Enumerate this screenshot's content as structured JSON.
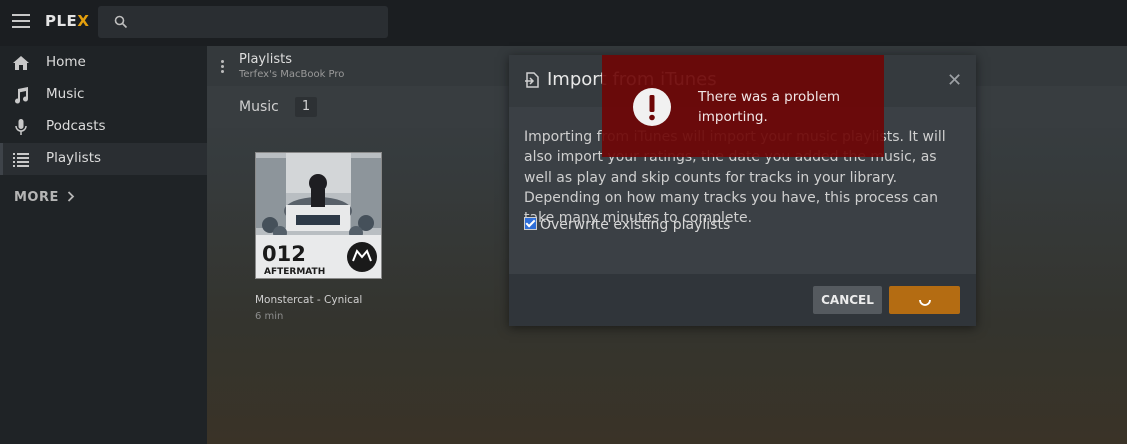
{
  "app": {
    "logo_main": "PLE",
    "logo_x": "X"
  },
  "search": {
    "placeholder": ""
  },
  "sidebar": {
    "items": [
      {
        "label": "Home",
        "icon": "home-icon"
      },
      {
        "label": "Music",
        "icon": "music-note-icon"
      },
      {
        "label": "Podcasts",
        "icon": "microphone-icon"
      },
      {
        "label": "Playlists",
        "icon": "list-icon",
        "active": true
      }
    ],
    "more": "MORE"
  },
  "header": {
    "title": "Playlists",
    "subtitle": "Terfex's MacBook Pro"
  },
  "filter": {
    "label": "Music",
    "count": "1"
  },
  "card": {
    "title": "Monstercat - Cynical",
    "meta": "6 min",
    "cover_text": "012",
    "cover_subtext": "AFTERMATH"
  },
  "dialog": {
    "title": "Import from iTunes",
    "body": "Importing from iTunes will import your music playlists. It will also import your ratings, the date you added the music, as well as play and skip counts for tracks in your library. Depending on how many tracks you have, this process can take many minutes to complete.",
    "checkbox_label": "Overwrite existing playlists",
    "checkbox_checked": true,
    "cancel_label": "CANCEL"
  },
  "toast": {
    "message": "There was a problem importing."
  },
  "colors": {
    "accent": "#e5a00d",
    "import_button": "#b46c12",
    "error": "#6e0606"
  }
}
